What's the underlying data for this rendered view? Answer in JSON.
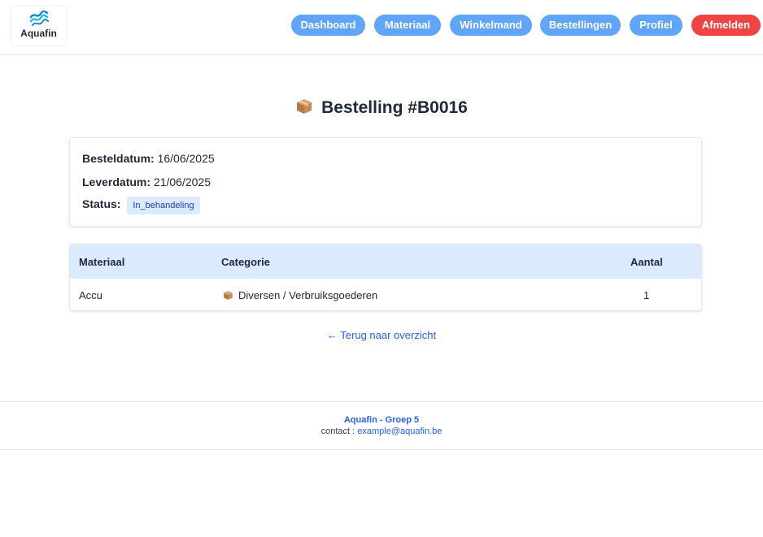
{
  "header": {
    "logo_text": "Aquafin",
    "nav": [
      {
        "label": "Dashboard"
      },
      {
        "label": "Materiaal"
      },
      {
        "label": "Winkelmand"
      },
      {
        "label": "Bestellingen"
      },
      {
        "label": "Profiel"
      }
    ],
    "logout_label": "Afmelden"
  },
  "page": {
    "title": "Bestelling #B0016"
  },
  "info": {
    "besteldatum_label": "Besteldatum:",
    "besteldatum_value": "16/06/2025",
    "leverdatum_label": "Leverdatum:",
    "leverdatum_value": "21/06/2025",
    "status_label": "Status:",
    "status_value": "In_behandeling"
  },
  "table": {
    "headers": [
      "Materiaal",
      "Categorie",
      "Aantal"
    ],
    "rows": [
      {
        "materiaal": "Accu",
        "categorie": "Diversen / Verbruiksgoederen",
        "aantal": "1"
      }
    ]
  },
  "back_link": "← Terug naar overzicht",
  "footer": {
    "title": "Aquafin - Groep 5",
    "contact_label": "contact :",
    "contact_email": "example@aquafin.be"
  },
  "colors": {
    "nav_button": "#60a5fa",
    "logout_button": "#ef4444",
    "table_header_bg": "#dbeafe",
    "link": "#2563eb"
  }
}
